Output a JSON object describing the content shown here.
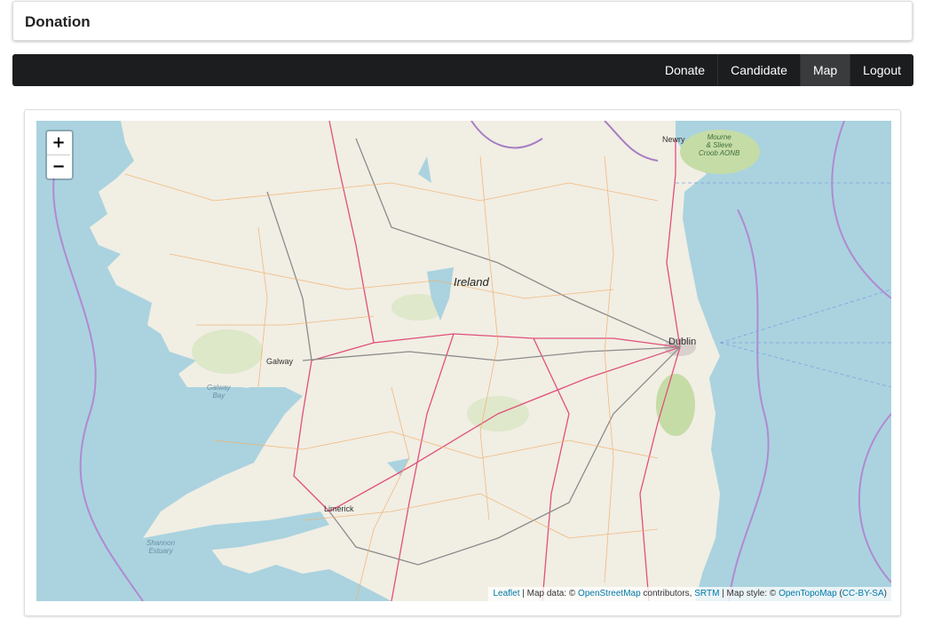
{
  "header": {
    "title": "Donation"
  },
  "nav": {
    "items": [
      {
        "label": "Donate"
      },
      {
        "label": "Candidate"
      },
      {
        "label": "Map"
      },
      {
        "label": "Logout"
      }
    ],
    "active": "Map"
  },
  "map": {
    "zoom_in": "+",
    "zoom_out": "−",
    "labels": {
      "country": "Ireland",
      "dublin": "Dublin",
      "galway": "Galway",
      "limerick": "Limerick",
      "newry": "Newry",
      "galway_bay": "Galway\nBay",
      "shannon": "Shannon\nEstuary",
      "mourne": "Mourne\n& Slieve\nCroob AONB"
    },
    "attribution": {
      "leaflet": "Leaflet",
      "sep1": " | Map data: © ",
      "osm": "OpenStreetMap",
      "contrib": " contributors, ",
      "srtm": "SRTM",
      "sep2": " | Map style: © ",
      "opentopo": "OpenTopoMap",
      "open_paren": " (",
      "license": "CC-BY-SA",
      "close_paren": ")"
    },
    "colors": {
      "sea": "#aad3df",
      "land": "#f1eee4",
      "road_major": "#e0507a",
      "road_minor": "#f2b06a",
      "border": "#a77fc2"
    }
  }
}
